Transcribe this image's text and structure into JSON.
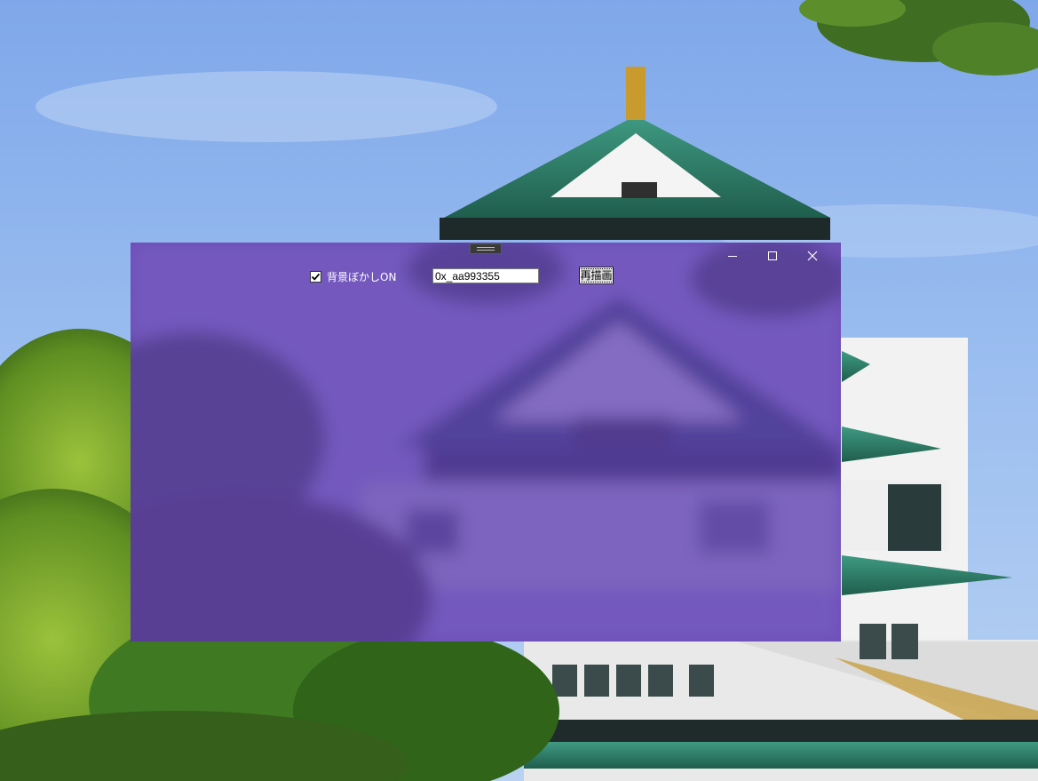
{
  "window": {
    "tint_color": "#6b48b4",
    "backdrop_blur": true,
    "caption_buttons": [
      "minimize-icon",
      "maximize-icon",
      "close-icon"
    ]
  },
  "controls": {
    "blur_checkbox": {
      "label": "背景ぼかしON",
      "checked": true
    },
    "color_input": {
      "value": "0x_aa993355"
    },
    "redraw_button": {
      "label": "再描画"
    }
  }
}
